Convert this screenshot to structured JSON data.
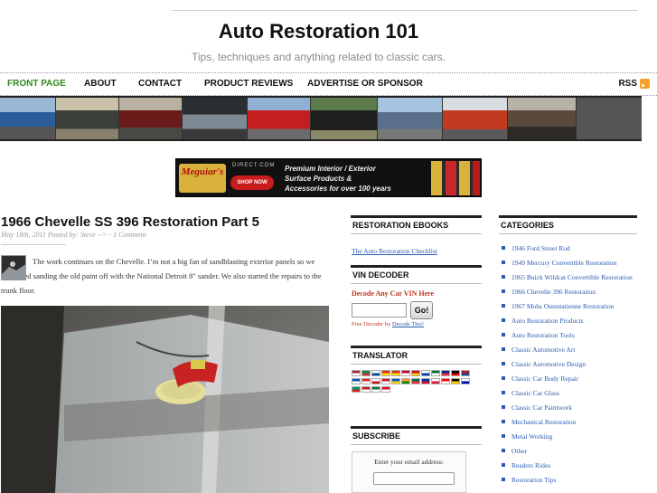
{
  "header": {
    "site_title": "Auto Restoration 101",
    "tagline": "Tips, techniques and anything related to classic cars."
  },
  "nav": {
    "items": [
      {
        "label": "FRONT PAGE",
        "active": true
      },
      {
        "label": "ABOUT",
        "active": false
      },
      {
        "label": "CONTACT",
        "active": false
      },
      {
        "label": "PRODUCT REVIEWS",
        "active": false
      },
      {
        "label": "ADVERTISE OR SPONSOR",
        "active": false
      }
    ],
    "rss_label": "RSS",
    "rss_icon": "rss-feed-icon"
  },
  "ad": {
    "brand": "Meguiar's",
    "domain": "DIRECT.COM",
    "shop_label": "SHOP NOW",
    "line1": "Premium Interior / Exterior",
    "line2": "Surface Products &",
    "line3": "Accessories for over 100 years"
  },
  "post": {
    "title": "1966 Chevelle SS 396 Restoration Part 5",
    "meta": "May 18th, 2011 Posted by: Steve --> - 1 Comment",
    "excerpt": "The work continues on the Chevelle. I’m not a big fan of sandblasting exterior panels so we continued sanding the old paint off with the National Detroit 8″ sander. We also started the repairs to the trunk floor."
  },
  "sidebar": {
    "ebooks": {
      "title": "RESTORATION EBOOKS",
      "link": "The Auto Restoration Checklist"
    },
    "vin": {
      "title": "VIN DECODER",
      "heading": "Decode Any Car VIN Here",
      "go_label": "Go!",
      "footer_prefix": "Free Decoder by",
      "footer_link": "Decode This!"
    },
    "translator": {
      "title": "TRANSLATOR"
    },
    "subscribe": {
      "title": "SUBSCRIBE",
      "label": "Enter your email address:"
    }
  },
  "categories": {
    "title": "CATEGORIES",
    "items": [
      "1946 Ford Street Rod",
      "1949 Mercury Convertible Restoration",
      "1965 Buick Wildcat Convertible Restoration",
      "1966 Chevelle 396 Restoration",
      "1967 Mohs Ostentatienne Restoration",
      "Auto Restoration Products",
      "Auto Restoration Tools",
      "Classic Automotive Art",
      "Classic Automotive Design",
      "Classic Car Body Repair",
      "Classic Car Glass",
      "Classic Car Paintwork",
      "Mechanical Restoration",
      "Metal Working",
      "Other",
      "Readers Rides",
      "Restoration Tips"
    ]
  },
  "colors": {
    "accent_green": "#2e8b1a",
    "link_blue": "#2a5bb0",
    "vin_red": "#c0331a"
  }
}
